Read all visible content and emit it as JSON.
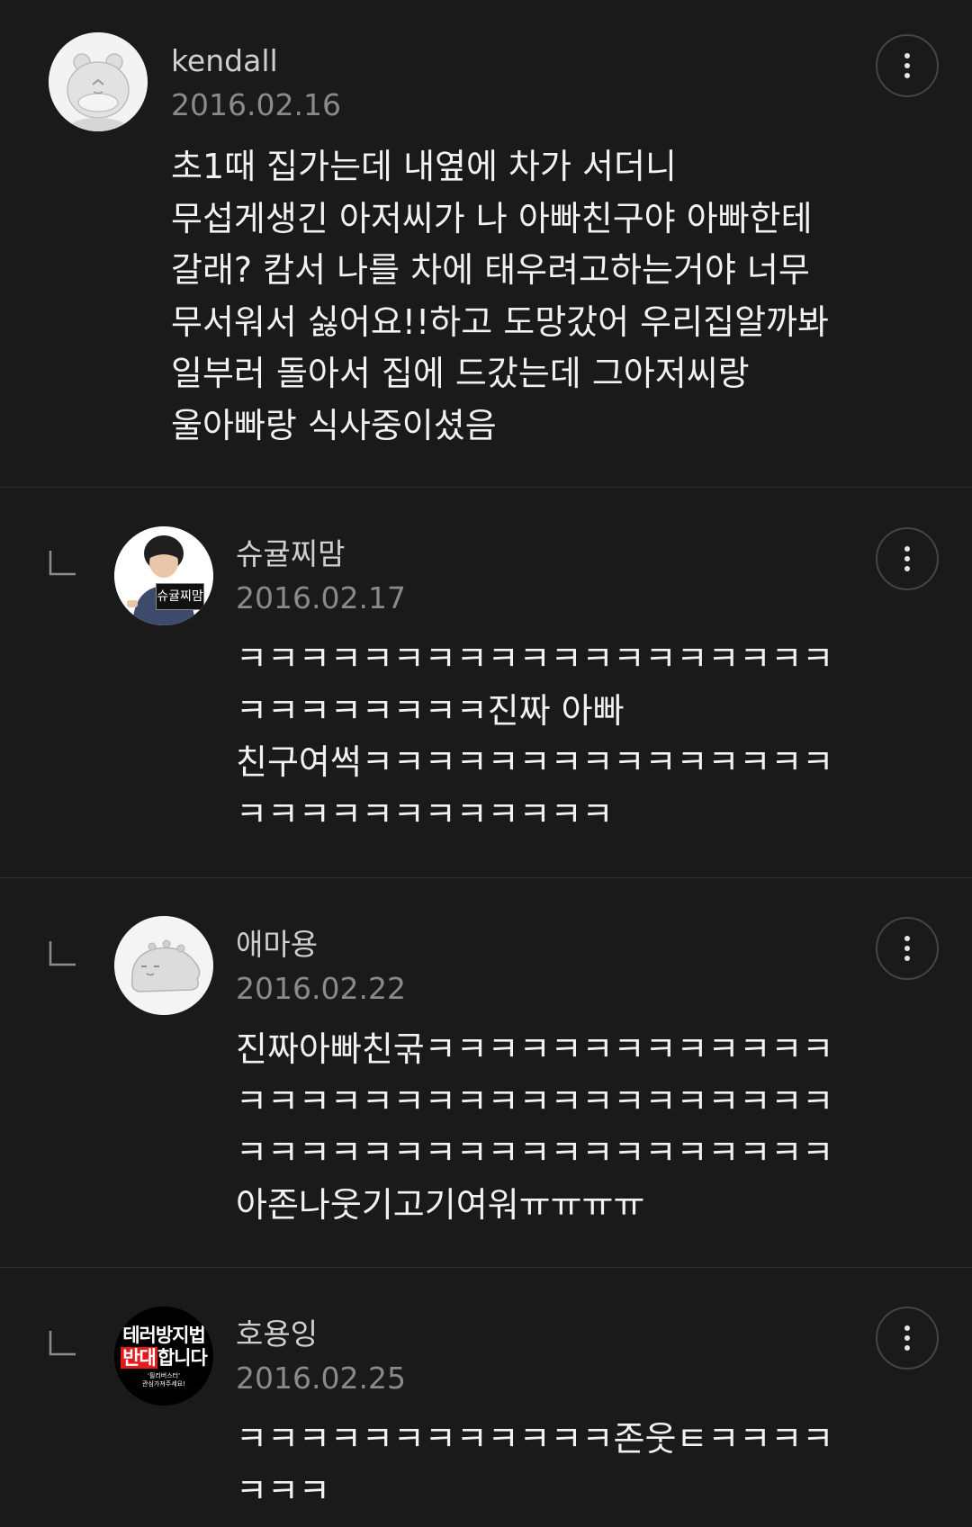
{
  "comments": [
    {
      "author": "kendall",
      "date": "2016.02.16",
      "text": "초1때 집가는데 내옆에 차가 서더니\n무섭게생긴 아저씨가 나 아빠친구야 아빠한테\n갈래? 캄서 나를 차에 태우려고하는거야 너무\n무서워서 싫어요!!하고 도망갔어 우리집알까봐\n일부러 돌아서 집에 드갔는데 그아저씨랑\n울아빠랑 식사중이셨음",
      "avatar_icon": "bear-character-icon",
      "is_reply": false
    },
    {
      "author": "슈귤찌맘",
      "date": "2016.02.17",
      "text": "ㅋㅋㅋㅋㅋㅋㅋㅋㅋㅋㅋㅋㅋㅋㅋㅋㅋㅋㅋ\nㅋㅋㅋㅋㅋㅋㅋㅋ진짜 아빠\n친구여썩ㅋㅋㅋㅋㅋㅋㅋㅋㅋㅋㅋㅋㅋㅋㅋ\nㅋㅋㅋㅋㅋㅋㅋㅋㅋㅋㅋㅋ",
      "avatar_icon": "person-photo-icon",
      "avatar_sign": "슈귤찌맘",
      "is_reply": true
    },
    {
      "author": "애마용",
      "date": "2016.02.22",
      "text": "진짜아빠친굮ㅋㅋㅋㅋㅋㅋㅋㅋㅋㅋㅋㅋㅋ\nㅋㅋㅋㅋㅋㅋㅋㅋㅋㅋㅋㅋㅋㅋㅋㅋㅋㅋㅋ\nㅋㅋㅋㅋㅋㅋㅋㅋㅋㅋㅋㅋㅋㅋㅋㅋㅋㅋㅋ\n아존나웃기고기여워ㅠㅠㅠㅠ",
      "avatar_icon": "creature-character-icon",
      "is_reply": true
    },
    {
      "author": "호용잉",
      "date": "2016.02.25",
      "text": "ㅋㅋㅋㅋㅋㅋㅋㅋㅋㅋㅋㅋ존웃ㅌㅋㅋㅋㅋ\nㅋㅋㅋ",
      "avatar_icon": "protest-badge-icon",
      "avatar_line1": "테러방지법",
      "avatar_line2a": "반대",
      "avatar_line2b": "합니다",
      "avatar_line3": "'필리버스터'",
      "avatar_line4": "관심가져주세요!",
      "is_reply": true
    }
  ],
  "colors": {
    "background": "#1a1a1a",
    "divider": "#2e2e2e",
    "author": "#cfcfcf",
    "date": "#8a8a8a",
    "body_text": "#f2f2f2"
  }
}
